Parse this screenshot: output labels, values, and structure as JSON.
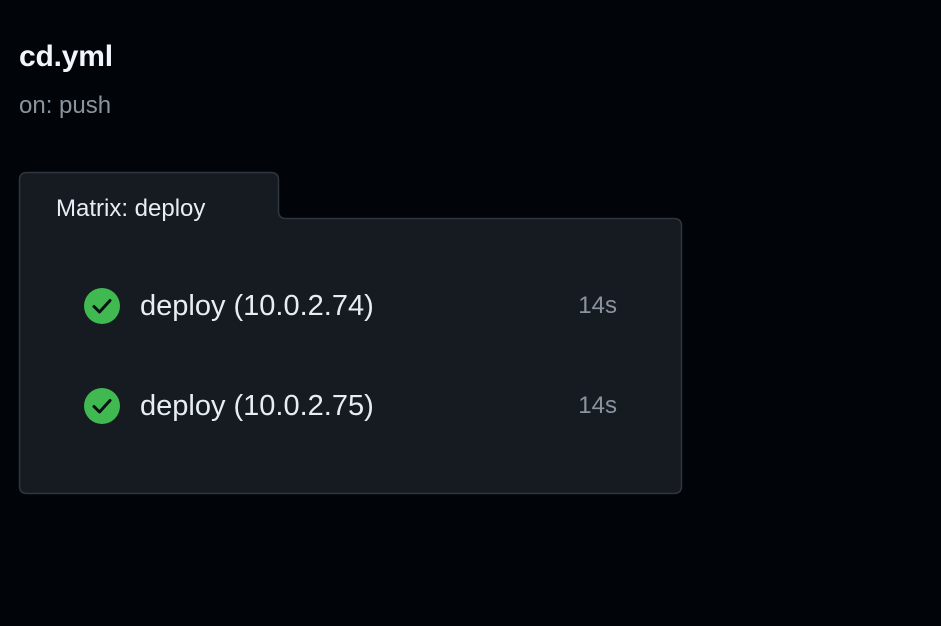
{
  "workflow": {
    "file_name": "cd.yml",
    "trigger": "on: push"
  },
  "matrix": {
    "label": "Matrix: deploy",
    "jobs": [
      {
        "name": "deploy (10.0.2.74)",
        "duration": "14s",
        "status": "success",
        "icon": "check-circle-icon"
      },
      {
        "name": "deploy (10.0.2.75)",
        "duration": "14s",
        "status": "success",
        "icon": "check-circle-icon"
      }
    ]
  },
  "colors": {
    "background": "#010409",
    "card_background": "#161b22",
    "card_border": "#30363d",
    "success": "#3fb950",
    "text_primary": "#e6edf3",
    "text_muted": "#8b949e"
  }
}
